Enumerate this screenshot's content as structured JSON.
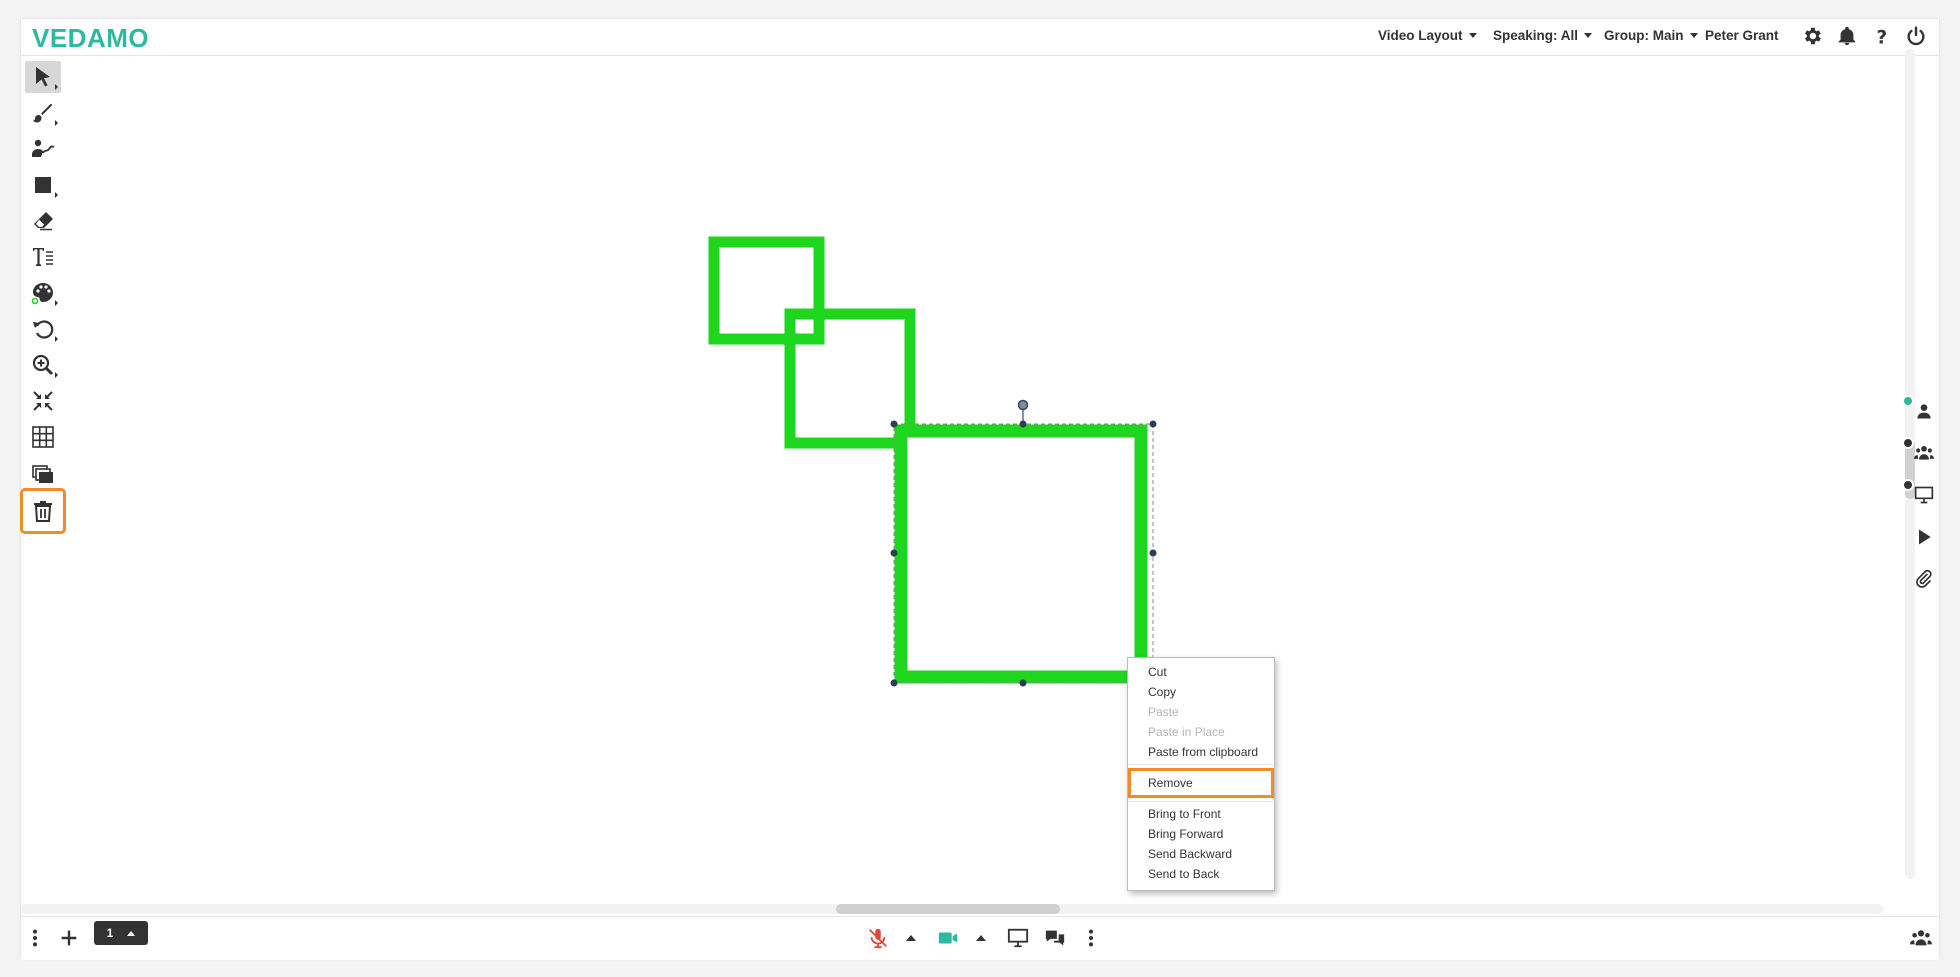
{
  "header": {
    "logo": "VEDAMO",
    "menus": [
      {
        "label": "Video Layout"
      },
      {
        "label": "Speaking: All"
      },
      {
        "label": "Group: Main"
      }
    ],
    "user_name": "Peter Grant",
    "icons": [
      "gear-icon",
      "bell-icon",
      "help-icon",
      "power-icon"
    ]
  },
  "toolbar": {
    "tools": [
      {
        "name": "select-tool",
        "icon": "pointer-arrow",
        "active": true
      },
      {
        "name": "brush-tool",
        "icon": "brush"
      },
      {
        "name": "presenter-pen-tool",
        "icon": "person-pen"
      },
      {
        "name": "shape-tool",
        "icon": "square"
      },
      {
        "name": "eraser-tool",
        "icon": "eraser"
      },
      {
        "name": "text-tool",
        "icon": "text"
      },
      {
        "name": "color-tool",
        "icon": "palette"
      },
      {
        "name": "undo-tool",
        "icon": "undo"
      },
      {
        "name": "zoom-tool",
        "icon": "magnifier-plus"
      },
      {
        "name": "fit-tool",
        "icon": "compress"
      },
      {
        "name": "grid-tool",
        "icon": "grid"
      },
      {
        "name": "layers-tool",
        "icon": "layers"
      },
      {
        "name": "delete-tool",
        "icon": "trash",
        "highlighted": true
      }
    ]
  },
  "canvas": {
    "shapes": [
      {
        "type": "rectangle",
        "stroke": "#1ed61e",
        "selected": false
      },
      {
        "type": "rectangle",
        "stroke": "#1ed61e",
        "selected": false
      },
      {
        "type": "rectangle",
        "stroke": "#1ed61e",
        "selected": true
      }
    ]
  },
  "context_menu": {
    "items": [
      {
        "label": "Cut",
        "enabled": true
      },
      {
        "label": "Copy",
        "enabled": true
      },
      {
        "label": "Paste",
        "enabled": false
      },
      {
        "label": "Paste in Place",
        "enabled": false
      },
      {
        "label": "Paste from clipboard",
        "enabled": true
      },
      {
        "label": "Remove",
        "enabled": true,
        "highlighted": true
      },
      {
        "label": "Bring to Front",
        "enabled": true
      },
      {
        "label": "Bring Forward",
        "enabled": true
      },
      {
        "label": "Send Backward",
        "enabled": true
      },
      {
        "label": "Send to Back",
        "enabled": true
      }
    ]
  },
  "right_rail": {
    "icons": [
      "user-camera-icon",
      "group-camera-icon",
      "screen-icon",
      "play-icon",
      "paperclip-icon"
    ]
  },
  "bottom_bar": {
    "page_number": "1",
    "icons": [
      "more-vertical-icon",
      "add-page-icon",
      "mic-muted-icon",
      "camera-icon",
      "screen-share-icon",
      "chat-icon",
      "more-vertical-icon",
      "participants-icon"
    ]
  },
  "colors": {
    "brand": "#2bb9a0",
    "shape_stroke": "#1ed61e",
    "highlight": "#f28c28",
    "mic_muted": "#e0463a"
  }
}
